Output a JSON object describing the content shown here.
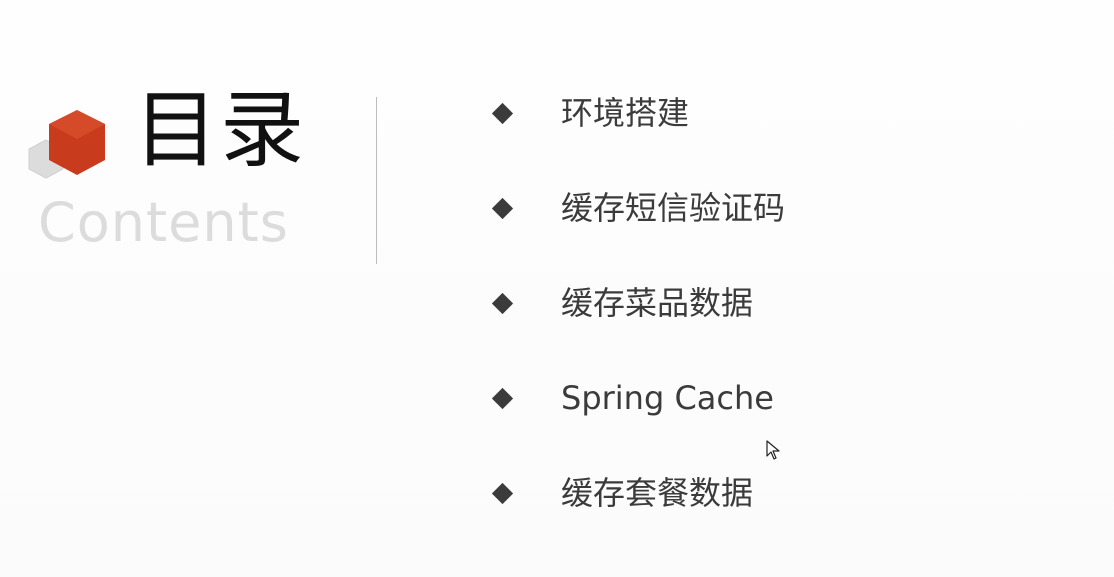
{
  "slide": {
    "title": "目录",
    "subtitle": "Contents",
    "accent_color": "#c93b1d",
    "secondary_shape_color": "#d9d9d9"
  },
  "menu": {
    "bullet_icon": "diamond-icon",
    "items": [
      {
        "label": "环境搭建"
      },
      {
        "label": "缓存短信验证码"
      },
      {
        "label": "缓存菜品数据"
      },
      {
        "label": "Spring Cache"
      },
      {
        "label": "缓存套餐数据"
      }
    ]
  },
  "cursor": {
    "icon": "mouse-pointer-icon"
  }
}
